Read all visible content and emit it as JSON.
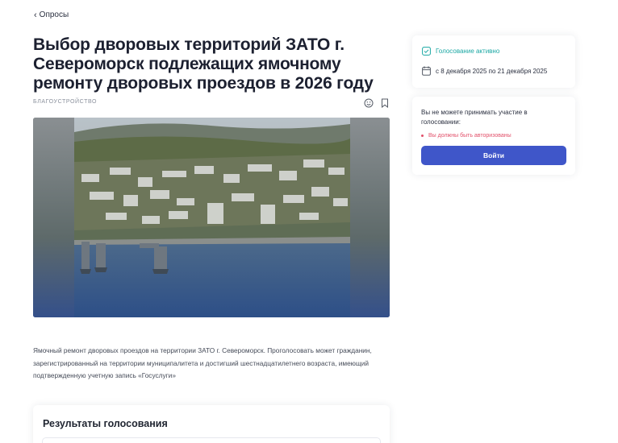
{
  "nav": {
    "back_label": "Опросы"
  },
  "poll": {
    "title": "Выбор дворовых территорий ЗАТО г. Североморск подлежащих ямочному ремонту дворовых проездов в 2026 году",
    "category": "БЛАГОУСТРОЙСТВО",
    "description": "Ямочный ремонт дворовых проездов на территории ЗАТО г. Североморск. Проголосовать может гражданин, зарегистрированный на территории муниципалитета и достигший шестнадцатилетнего возраста, имеющий подтвержденную учетную запись «Госуслуги»"
  },
  "results": {
    "title": "Результаты голосования"
  },
  "status": {
    "label": "Голосование активно",
    "dates": "с 8 декабря 2025 по 21 декабря 2025"
  },
  "auth": {
    "message": "Вы не можете принимать участие в голосовании:",
    "error": "Вы должны быть авторизованы",
    "login_label": "Войти"
  },
  "icons": {
    "back": "chevron-left-icon",
    "emoji": "smile-icon",
    "bookmark": "bookmark-icon",
    "status": "checkbox-icon",
    "calendar": "calendar-icon"
  },
  "colors": {
    "accent": "#3f56c9",
    "status": "#1aa7a3",
    "error": "#e2506a"
  }
}
